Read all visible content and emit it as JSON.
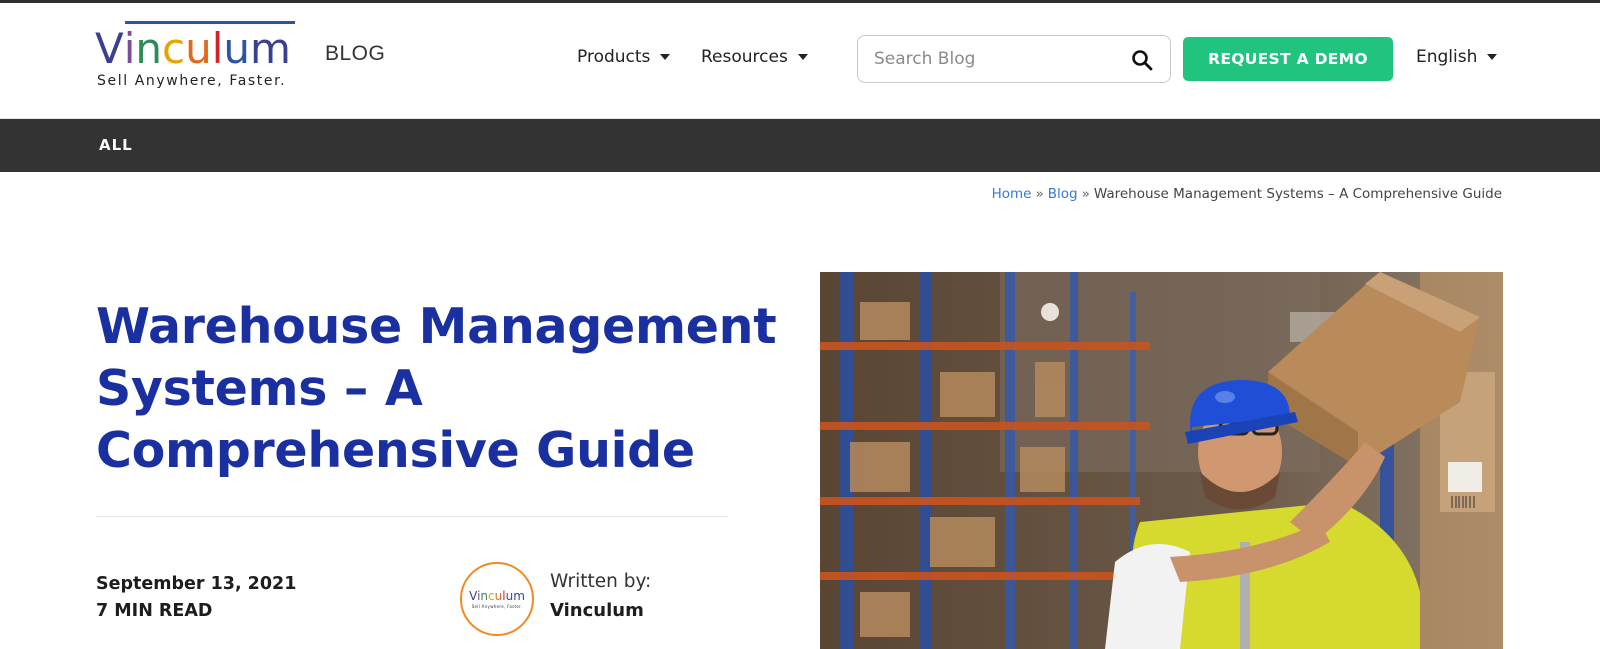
{
  "header": {
    "logo": {
      "letters": [
        {
          "char": "V",
          "color": "#3a3f8f"
        },
        {
          "char": "i",
          "color": "#7a4b9a"
        },
        {
          "char": "n",
          "color": "#2e8b57"
        },
        {
          "char": "c",
          "color": "#e6a400"
        },
        {
          "char": "u",
          "color": "#e06a1c"
        },
        {
          "char": "l",
          "color": "#d2232a"
        },
        {
          "char": "u",
          "color": "#2b54a3"
        },
        {
          "char": "m",
          "color": "#3a3f8f"
        }
      ],
      "tagline": "Sell Anywhere, Faster."
    },
    "blog_label": "BLOG",
    "nav": {
      "products": "Products",
      "resources": "Resources"
    },
    "search": {
      "placeholder": "Search Blog",
      "value": ""
    },
    "demo_button": "REQUEST A DEMO",
    "language": "English"
  },
  "category_bar": {
    "items": [
      "ALL"
    ]
  },
  "breadcrumb": {
    "home": "Home",
    "separator": "»",
    "blog": "Blog",
    "current": "Warehouse Management Systems – A Comprehensive Guide"
  },
  "article": {
    "title": "Warehouse Management Systems – A Comprehensive Guide",
    "date": "September 13, 2021",
    "read_time": "7 MIN READ",
    "written_by_label": "Written by:",
    "author": "Vinculum",
    "author_avatar_word": "Vinculum",
    "author_avatar_tagline": "Sell Anywhere, Faster."
  },
  "colors": {
    "title": "#1a2fa0",
    "demo_button": "#21c47f",
    "category_bar": "#333333",
    "link": "#3a78d6",
    "avatar_ring": "#f08a22"
  },
  "icons": {
    "search": "search-icon",
    "caret": "caret-down-icon"
  }
}
